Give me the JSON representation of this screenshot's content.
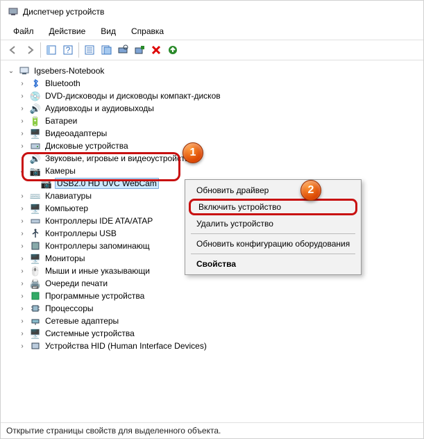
{
  "window": {
    "title": "Диспетчер устройств"
  },
  "menu": {
    "file": "Файл",
    "action": "Действие",
    "view": "Вид",
    "help": "Справка"
  },
  "tree": {
    "root": "Igsebers-Notebook",
    "nodes": {
      "bluetooth": "Bluetooth",
      "dvd": "DVD-дисководы и дисководы компакт-дисков",
      "audio": "Аудиовходы и аудиовыходы",
      "batteries": "Батареи",
      "video": "Видеоадаптеры",
      "disk": "Дисковые устройства",
      "sound": "Звуковые, игровые и видеоустройства",
      "cameras": "Камеры",
      "camera_item": "USB2.0 HD UVC WebCam",
      "keyboards": "Клавиатуры",
      "computer": "Компьютер",
      "ide": "Контроллеры IDE ATA/ATAP",
      "usb": "Контроллеры USB",
      "storage": "Контроллеры запоминающ",
      "monitors": "Мониторы",
      "mice": "Мыши и иные указывающи",
      "print": "Очереди печати",
      "software": "Программные устройства",
      "cpu": "Процессоры",
      "network": "Сетевые адаптеры",
      "system": "Системные устройства",
      "hid": "Устройства HID (Human Interface Devices)"
    }
  },
  "context": {
    "update": "Обновить драйвер",
    "enable": "Включить устройство",
    "delete": "Удалить устройство",
    "scan": "Обновить конфигурацию оборудования",
    "properties": "Свойства"
  },
  "markers": {
    "one": "1",
    "two": "2"
  },
  "status": "Открытие страницы свойств для выделенного объекта."
}
